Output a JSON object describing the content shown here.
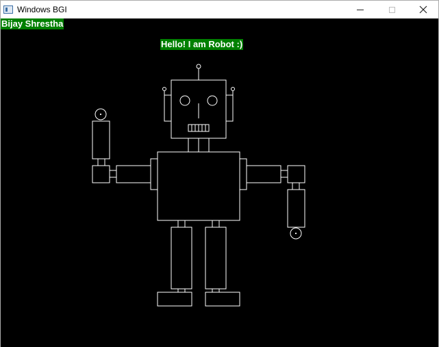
{
  "window": {
    "title": "Windows BGI",
    "controls": {
      "minimize": "minimize",
      "maximize": "maximize",
      "close": "close"
    }
  },
  "canvas": {
    "author_label": "Bijay Shrestha",
    "greeting_label": "Hello! I am Robot :)"
  },
  "colors": {
    "canvas_background": "#000000",
    "label_background": "#008000",
    "label_text": "#ffffff",
    "outline": "#ffffff"
  },
  "icons": [
    "app-icon",
    "minimize-icon",
    "maximize-icon",
    "close-icon"
  ]
}
